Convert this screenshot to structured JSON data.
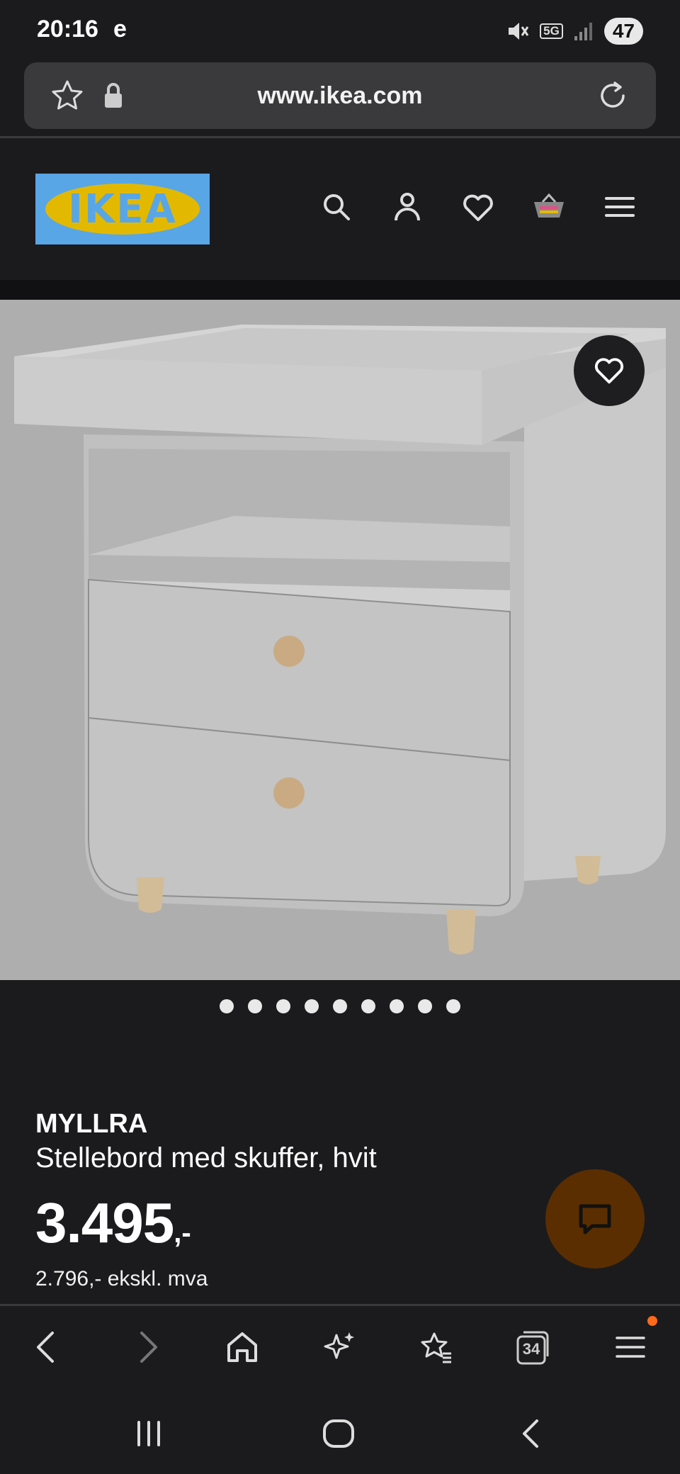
{
  "status_bar": {
    "time": "20:16",
    "carrier_glyph": "e",
    "network": "5G",
    "battery": "47",
    "icons": [
      "mute-icon",
      "signal-icon"
    ]
  },
  "url_bar": {
    "url": "www.ikea.com",
    "icons": [
      "bookmark-star-icon",
      "lock-icon",
      "reload-icon"
    ]
  },
  "site_header": {
    "logo_text": "IKEA",
    "icons": [
      "search-icon",
      "account-icon",
      "wishlist-heart-icon",
      "basket-icon",
      "menu-icon"
    ]
  },
  "product": {
    "image_alt": "MYLLRA changing table with drawers, white",
    "name": "MYLLRA",
    "description": "Stellebord med skuffer, hvit",
    "price": "3.495",
    "price_suffix": ",-",
    "price_excl_vat": "2.796,- ekskl. mva",
    "image_count": 9,
    "active_image": 1
  },
  "browser_bar": {
    "tabs_count": "34",
    "icons": [
      "back-icon",
      "forward-icon",
      "home-icon",
      "sparkle-icon",
      "bookmarks-icon",
      "tabs-icon",
      "menu-icon"
    ]
  },
  "system_nav": {
    "icons": [
      "recents-icon",
      "home-icon",
      "back-icon"
    ]
  },
  "colors": {
    "background": "#1b1b1d",
    "image_bg": "#aeaeae",
    "ikea_blue": "#58a6e6",
    "ikea_yellow": "#e3b900",
    "chat_button": "#5b2e00",
    "notification": "#ff6a1a"
  }
}
